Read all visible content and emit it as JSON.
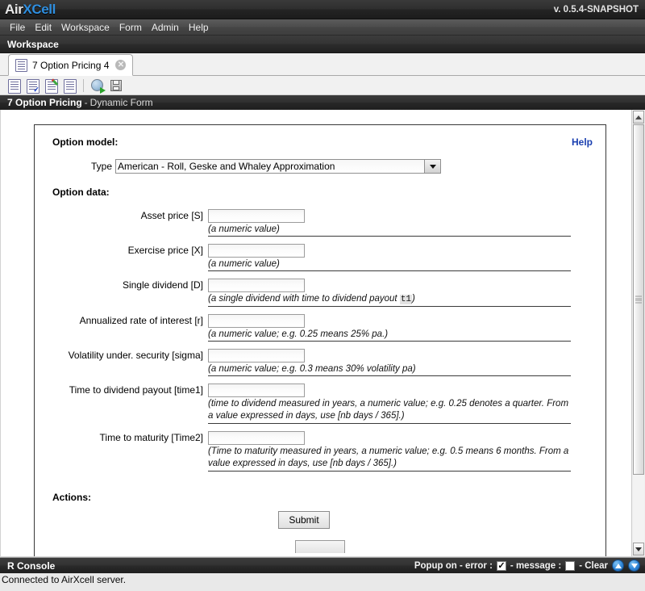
{
  "titlebar": {
    "logo_air": "Air",
    "logo_x": "X",
    "logo_cell": "Cell",
    "version": "v. 0.5.4-SNAPSHOT"
  },
  "menubar": {
    "items": [
      {
        "label": "File"
      },
      {
        "label": "Edit"
      },
      {
        "label": "Workspace"
      },
      {
        "label": "Form"
      },
      {
        "label": "Admin"
      },
      {
        "label": "Help"
      }
    ]
  },
  "workspace_header": {
    "title": "Workspace"
  },
  "tabs": [
    {
      "label": "7 Option Pricing 4",
      "close": "✕",
      "icon": "document-icon"
    }
  ],
  "form_toolbar": {
    "buttons": [
      {
        "name": "new-form-icon"
      },
      {
        "name": "validate-form-icon"
      },
      {
        "name": "edit-form-icon"
      },
      {
        "name": "view-form-icon"
      },
      {
        "name": "run-form-icon"
      },
      {
        "name": "save-form-icon"
      }
    ]
  },
  "form_title": {
    "name": "7 Option Pricing",
    "dash": "-",
    "kind": "Dynamic Form"
  },
  "form": {
    "model_section_label": "Option model:",
    "help_label": "Help",
    "type_label": "Type",
    "type_value": "American - Roll, Geske and Whaley Approximation",
    "data_section_label": "Option data:",
    "fields": [
      {
        "label": "Asset price [S]",
        "value": "",
        "hint_pre": "(a numeric value)",
        "hint_code": "",
        "hint_post": ""
      },
      {
        "label": "Exercise price [X]",
        "value": "",
        "hint_pre": "(a numeric value)",
        "hint_code": "",
        "hint_post": ""
      },
      {
        "label": "Single dividend [D]",
        "value": "",
        "hint_pre": "(a single dividend with time to dividend payout ",
        "hint_code": "t1",
        "hint_post": ")"
      },
      {
        "label": "Annualized rate of interest [r]",
        "value": "",
        "hint_pre": "(a numeric value; e.g. 0.25 means 25% pa.)",
        "hint_code": "",
        "hint_post": ""
      },
      {
        "label": "Volatility under. security [sigma]",
        "value": "",
        "hint_pre": "(a numeric value; e.g. 0.3 means 30% volatility pa)",
        "hint_code": "",
        "hint_post": ""
      },
      {
        "label": "Time to dividend payout [time1]",
        "value": "",
        "hint_pre": "(time to dividend measured in years, a numeric value; e.g. 0.25 denotes a quarter. From a value expressed in days, use [nb days / 365].)",
        "hint_code": "",
        "hint_post": ""
      },
      {
        "label": "Time to maturity [Time2]",
        "value": "",
        "hint_pre": "(Time to maturity measured in years, a numeric value; e.g. 0.5 means 6 months. From a value expressed in days, use [nb days / 365].)",
        "hint_code": "",
        "hint_post": ""
      }
    ],
    "actions_label": "Actions:",
    "submit_label": "Submit"
  },
  "console": {
    "title": "R Console",
    "popup_label": "Popup on - error :",
    "error_checked": true,
    "message_label": "- message :",
    "message_checked": false,
    "clear_label": "- Clear",
    "scroll_up_icon": "arrow-up-icon",
    "scroll_down_icon": "arrow-down-icon",
    "output": "Connected to AirXcell server."
  }
}
